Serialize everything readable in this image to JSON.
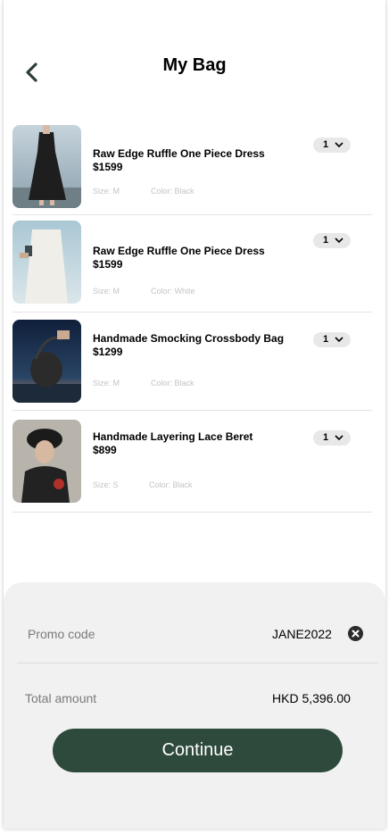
{
  "header": {
    "title": "My Bag",
    "back_icon": "chevron-left-icon"
  },
  "cart": {
    "items": [
      {
        "name": "Raw Edge Ruffle One Piece Dress",
        "price": "$1599",
        "size": "Size: M",
        "color": "Color: Black",
        "quantity": "1"
      },
      {
        "name": "Raw Edge Ruffle One Piece Dress",
        "price": "$1599",
        "size": "Size: M",
        "color": "Color: White",
        "quantity": "1"
      },
      {
        "name": "Handmade Smocking Crossbody Bag",
        "price": "$1299",
        "size": "Size: M",
        "color": "Color: Black",
        "quantity": "1"
      },
      {
        "name": "Handmade Layering Lace Beret",
        "price": "$899",
        "size": "Size: S",
        "color": "Color: Black",
        "quantity": "1"
      }
    ]
  },
  "summary": {
    "promo_label": "Promo code",
    "promo_value": "JANE2022",
    "total_label": "Total amount",
    "total_value": "HKD 5,396.00",
    "continue_label": "Continue"
  },
  "colors": {
    "accent": "#2e4a3c",
    "panel": "#f1f1f1",
    "qty_pill": "#e8e8e8"
  }
}
